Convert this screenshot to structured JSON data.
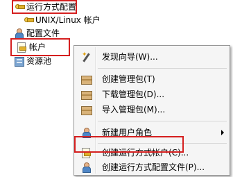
{
  "tree": {
    "items": [
      {
        "label": "运行方式配置"
      },
      {
        "label": "UNIX/Linux 帐户"
      },
      {
        "label": "配置文件"
      },
      {
        "label": "帐户"
      },
      {
        "label": "资源池"
      }
    ]
  },
  "context_menu": {
    "items": [
      {
        "label": "发现向导(W)..."
      },
      {
        "label": "创建管理包(T)"
      },
      {
        "label": "下载管理包(D)..."
      },
      {
        "label": "导入管理包(M)..."
      },
      {
        "label": "新建用户角色"
      },
      {
        "label": "创建运行方式帐户(C)..."
      },
      {
        "label": "创建运行方式配置文件(P)..."
      }
    ]
  },
  "colors": {
    "highlight_box": "#d51f1f",
    "menu_bg": "#f5f5f5"
  }
}
